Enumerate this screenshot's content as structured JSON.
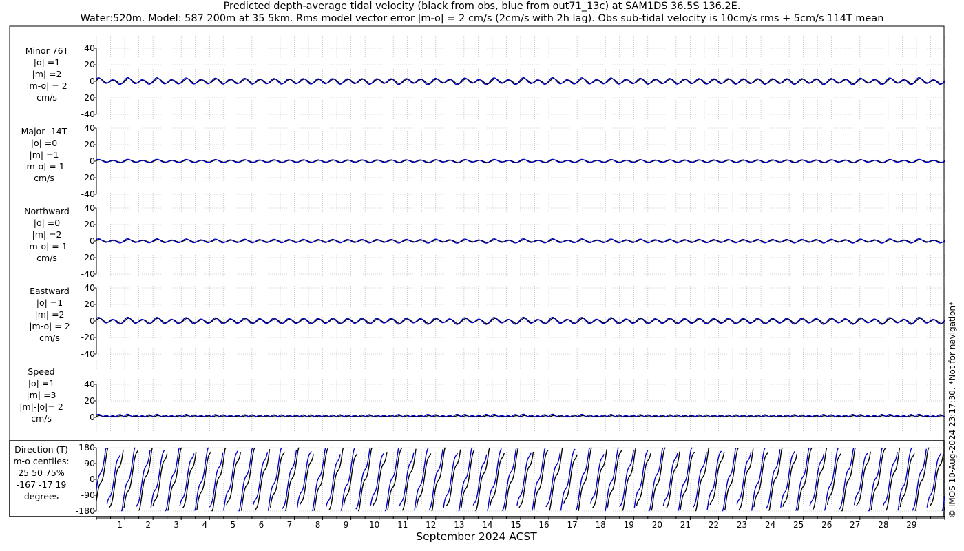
{
  "title_line1": "Predicted depth-average tidal velocity (black from obs, blue from out71_13c) at SAM1DS 36.5S 136.2E.",
  "title_line2": "Water:520m. Model: 587 200m at 35 5km. Rms model vector error |m-o| = 2 cm/s (2cm/s with 2h lag). Obs sub-tidal velocity is 10cm/s rms + 5cm/s 114T mean",
  "credit": "© IMOS 10-Aug-2024 23:17:30. *Not for navigation*",
  "colors": {
    "obs": "#000000",
    "model": "#0000cc",
    "grid": "#aaaaaa"
  },
  "chart_data": {
    "type": "line",
    "xlabel": "September 2024 ACST",
    "x_ticks": [
      1,
      2,
      3,
      4,
      5,
      6,
      7,
      8,
      9,
      10,
      11,
      12,
      13,
      14,
      15,
      16,
      17,
      18,
      19,
      20,
      21,
      22,
      23,
      24,
      25,
      26,
      27,
      28,
      29
    ],
    "xlim": [
      0,
      30
    ],
    "grid": true,
    "series_legend": {
      "obs": "black from obs",
      "model": "blue from out71_13c"
    },
    "panels": [
      {
        "id": "minor",
        "label": [
          "Minor 76T",
          "|o| =1",
          "|m| =2",
          "|m-o| = 2",
          "cm/s"
        ],
        "ylim": [
          -40,
          40
        ],
        "y_ticks": [
          40,
          20,
          0,
          -20,
          -40
        ],
        "obs_amp": 3,
        "model_amp": 4
      },
      {
        "id": "major",
        "label": [
          "Major -14T",
          "|o| =0",
          "|m| =1",
          "|m-o| = 1",
          "cm/s"
        ],
        "ylim": [
          -40,
          40
        ],
        "y_ticks": [
          40,
          20,
          0,
          -20,
          -40
        ],
        "obs_amp": 1.5,
        "model_amp": 2
      },
      {
        "id": "north",
        "label": [
          "Northward",
          "|o| =0",
          "|m| =2",
          "|m-o| = 1",
          "cm/s"
        ],
        "ylim": [
          -40,
          40
        ],
        "y_ticks": [
          40,
          20,
          0,
          -20,
          -40
        ],
        "obs_amp": 1.5,
        "model_amp": 2.5
      },
      {
        "id": "east",
        "label": [
          "Eastward",
          "|o| =1",
          "|m| =2",
          "|m-o| = 2",
          "cm/s"
        ],
        "ylim": [
          -40,
          40
        ],
        "y_ticks": [
          40,
          20,
          0,
          -20,
          -40
        ],
        "obs_amp": 3,
        "model_amp": 4
      },
      {
        "id": "speed",
        "label": [
          "Speed",
          "|o| =1",
          "|m| =3",
          "|m|-|o|= 2",
          "cm/s"
        ],
        "ylim": [
          0,
          40
        ],
        "y_ticks": [
          40,
          20,
          0
        ],
        "obs_amp": 1.5,
        "model_amp": 3
      },
      {
        "id": "direction",
        "label": [
          "Direction (T)",
          "m-o centiles:",
          "25  50  75%",
          "-167  -17   19",
          "degrees"
        ],
        "ylim": [
          -180,
          180
        ],
        "y_ticks": [
          180,
          90,
          0,
          -90,
          -180
        ]
      }
    ]
  }
}
